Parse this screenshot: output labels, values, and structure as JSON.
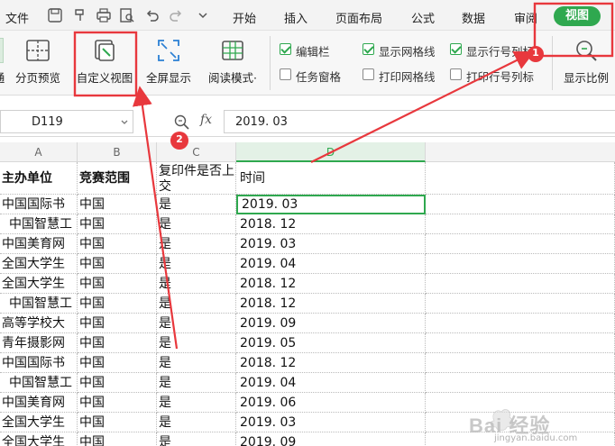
{
  "menu": {
    "file": "文件",
    "tabs": [
      "开始",
      "插入",
      "页面布局",
      "公式",
      "数据",
      "审阅"
    ],
    "active_tab": "视图"
  },
  "ribbon": {
    "partial_left_label": "通",
    "page_break_preview": "分页预览",
    "custom_view": "自定义视图",
    "full_screen": "全屏显示",
    "reading_mode": "阅读模式·",
    "checkboxes": [
      {
        "label": "编辑栏",
        "checked": true
      },
      {
        "label": "任务窗格",
        "checked": false
      },
      {
        "label": "显示网格线",
        "checked": true
      },
      {
        "label": "打印网格线",
        "checked": false
      },
      {
        "label": "显示行号列标",
        "checked": true
      },
      {
        "label": "打印行号列标",
        "checked": false
      }
    ],
    "zoom_display": "显示比例"
  },
  "formula_bar": {
    "cell_ref": "D119",
    "fx": "fx",
    "value": "2019. 03"
  },
  "grid": {
    "columns": [
      "A",
      "B",
      "C",
      "D"
    ],
    "header_row": [
      "主办单位",
      "竞赛范围",
      "复印件是否上交",
      "时间"
    ],
    "rows": [
      [
        "中国国际书",
        "中国",
        "是",
        "2019. 03"
      ],
      [
        "中国智慧工",
        "中国",
        "是",
        "2018. 12"
      ],
      [
        "中国美育网",
        "中国",
        "是",
        "2019. 03"
      ],
      [
        "全国大学生",
        "中国",
        "是",
        "2019. 04"
      ],
      [
        "全国大学生",
        "中国",
        "是",
        "2018. 12"
      ],
      [
        "中国智慧工",
        "中国",
        "是",
        "2018. 12"
      ],
      [
        "高等学校大",
        "中国",
        "是",
        "2019. 09"
      ],
      [
        "青年摄影网",
        "中国",
        "是",
        "2019. 05"
      ],
      [
        "中国国际书",
        "中国",
        "是",
        "2018. 12"
      ],
      [
        "中国智慧工",
        "中国",
        "是",
        "2019. 04"
      ],
      [
        "中国美育网",
        "中国",
        "是",
        "2019. 06"
      ],
      [
        "全国大学生",
        "中国",
        "是",
        "2019. 03"
      ],
      [
        "全国大学生",
        "中国",
        "是",
        "2019. 09"
      ]
    ]
  },
  "annotations": {
    "badge1": "1",
    "badge2": "2",
    "accent": "#e8383d",
    "watermark": "Bai 经验",
    "watermark_url": "jingyan.baidu.com"
  },
  "colors": {
    "view_tab": "#2fa84f",
    "highlight_box": "#e8383d",
    "selected_column": "#2fa84f"
  }
}
